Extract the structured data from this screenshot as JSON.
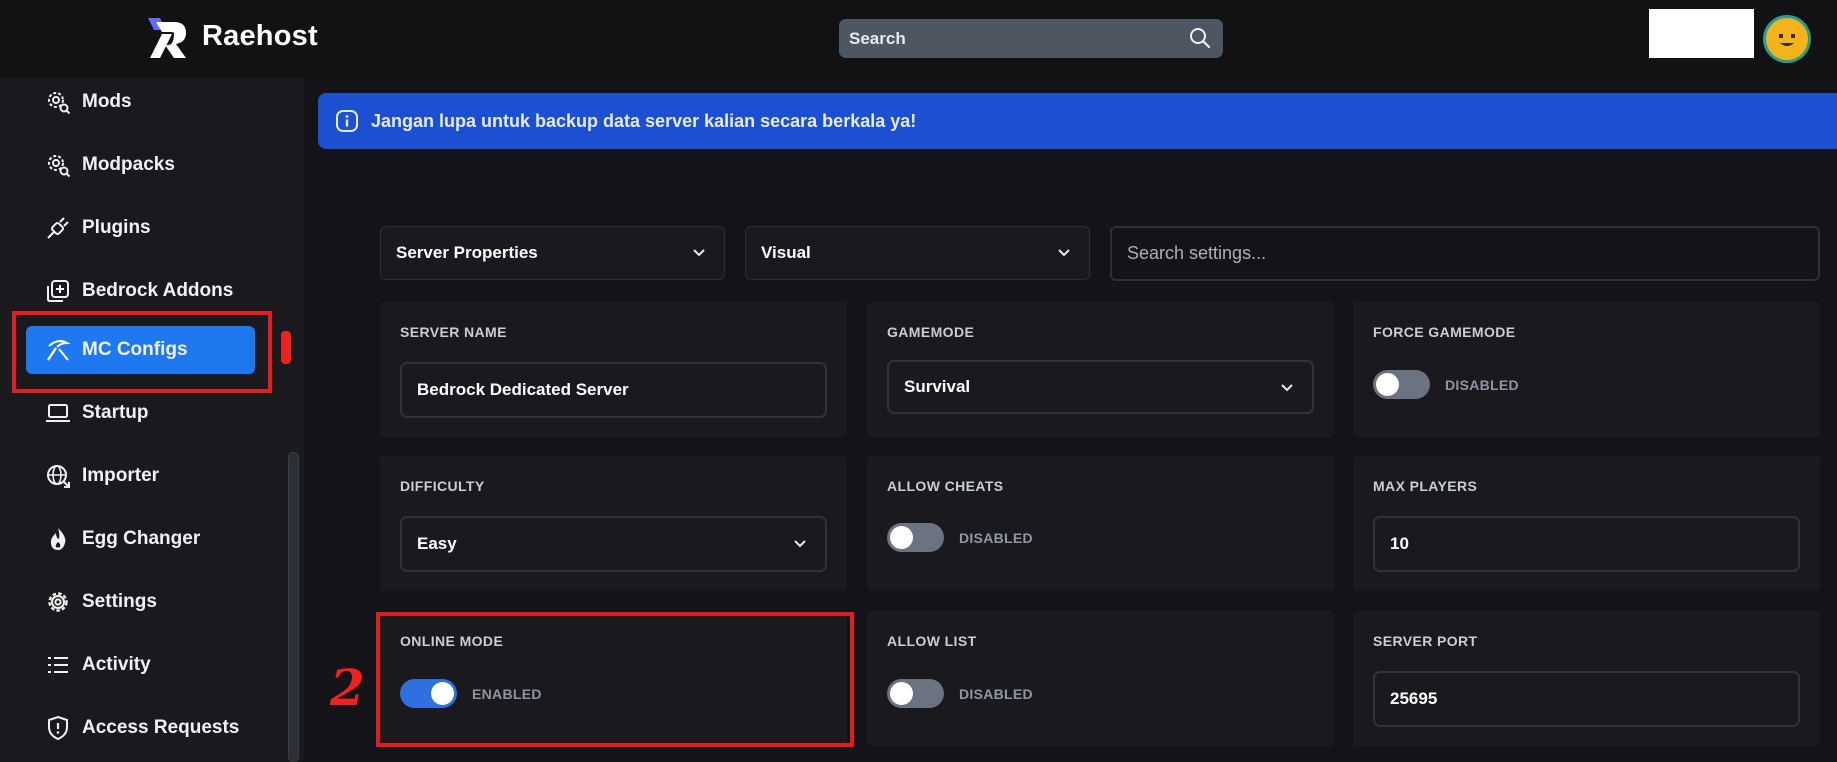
{
  "header": {
    "brand": "Raehost",
    "search_placeholder": "Search"
  },
  "sidebar": {
    "items": [
      {
        "label": "Mods",
        "icon": "gear-search-icon"
      },
      {
        "label": "Modpacks",
        "icon": "gear-search-icon"
      },
      {
        "label": "Plugins",
        "icon": "plug-icon"
      },
      {
        "label": "Bedrock Addons",
        "icon": "copy-plus-icon"
      },
      {
        "label": "MC Configs",
        "icon": "pickaxe-icon",
        "active": true
      },
      {
        "label": "Startup",
        "icon": "laptop-icon"
      },
      {
        "label": "Importer",
        "icon": "globe-icon"
      },
      {
        "label": "Egg Changer",
        "icon": "flame-icon"
      },
      {
        "label": "Settings",
        "icon": "gear-icon"
      },
      {
        "label": "Activity",
        "icon": "list-icon"
      },
      {
        "label": "Access Requests",
        "icon": "shield-icon"
      }
    ]
  },
  "banner": {
    "text": "Jangan lupa untuk backup data server kalian secara berkala ya!",
    "icon": "info-icon"
  },
  "filters": {
    "config_file": "Server Properties",
    "view_mode": "Visual",
    "search_placeholder": "Search settings..."
  },
  "settings": {
    "server_name": {
      "label": "SERVER NAME",
      "value": "Bedrock Dedicated Server"
    },
    "gamemode": {
      "label": "GAMEMODE",
      "value": "Survival"
    },
    "force_gamemode": {
      "label": "FORCE GAMEMODE",
      "state": "DISABLED"
    },
    "difficulty": {
      "label": "DIFFICULTY",
      "value": "Easy"
    },
    "allow_cheats": {
      "label": "ALLOW CHEATS",
      "state": "DISABLED"
    },
    "max_players": {
      "label": "MAX PLAYERS",
      "value": "10"
    },
    "online_mode": {
      "label": "ONLINE MODE",
      "state": "ENABLED"
    },
    "allow_list": {
      "label": "ALLOW LIST",
      "state": "DISABLED"
    },
    "server_port": {
      "label": "SERVER PORT",
      "value": "25695"
    }
  },
  "annotation": {
    "step": "2",
    "color": "#e11d22"
  },
  "colors": {
    "accent": "#1e78f0",
    "banner": "#1d4fd3",
    "highlight": "#e11d22"
  }
}
